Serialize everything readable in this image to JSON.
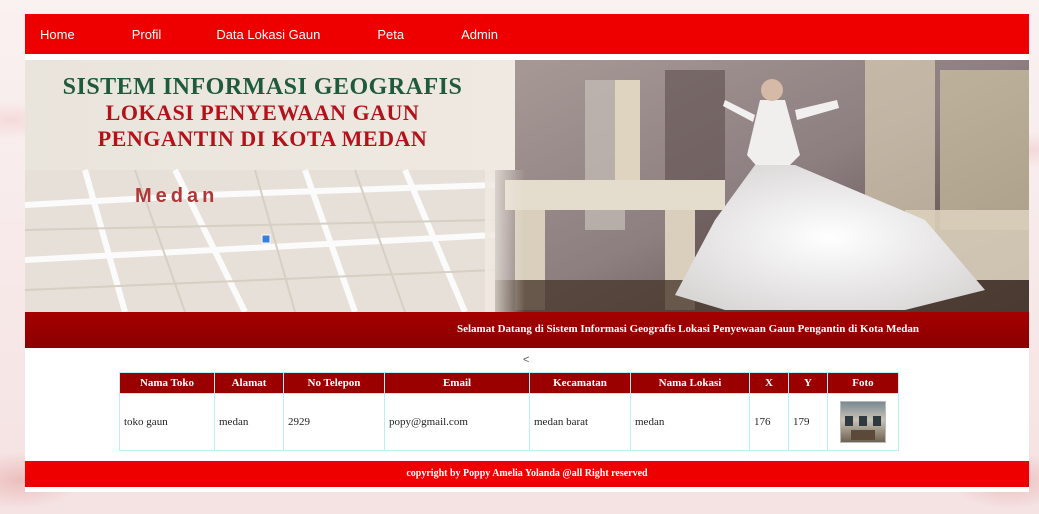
{
  "nav": {
    "items": [
      {
        "label": "Home"
      },
      {
        "label": "Profil"
      },
      {
        "label": "Data Lokasi Gaun"
      },
      {
        "label": "Peta"
      },
      {
        "label": "Admin"
      }
    ]
  },
  "banner": {
    "title_line1": "SISTEM INFORMASI GEOGRAFIS",
    "title_line2": "LOKASI PENYEWAAN GAUN",
    "title_line3": "PENGANTIN DI KOTA MEDAN",
    "map_city": "Medan"
  },
  "welcome": {
    "text": "Selamat Datang di Sistem Informasi Geografis Lokasi Penyewaan Gaun Pengantin di Kota Medan",
    "marquee_arrow": "<"
  },
  "table": {
    "headers": [
      "Nama Toko",
      "Alamat",
      "No Telepon",
      "Email",
      "Kecamatan",
      "Nama Lokasi",
      "X",
      "Y",
      "Foto"
    ],
    "rows": [
      {
        "nama_toko": "toko gaun",
        "alamat": "medan",
        "no_telepon": "2929",
        "email": "popy@gmail.com",
        "kecamatan": "medan barat",
        "nama_lokasi": "medan",
        "x": "176",
        "y": "179",
        "foto": "store-photo"
      }
    ]
  },
  "footer": {
    "text": "copyright by Poppy Amelia Yolanda @all Right reserved"
  },
  "colors": {
    "nav_bg": "#ee0000",
    "welcome_bg": "#9a0000",
    "table_header_bg": "#9a0000",
    "table_border": "#b8f0f8",
    "title_green": "#1f5a3c",
    "title_red": "#b3121a"
  }
}
